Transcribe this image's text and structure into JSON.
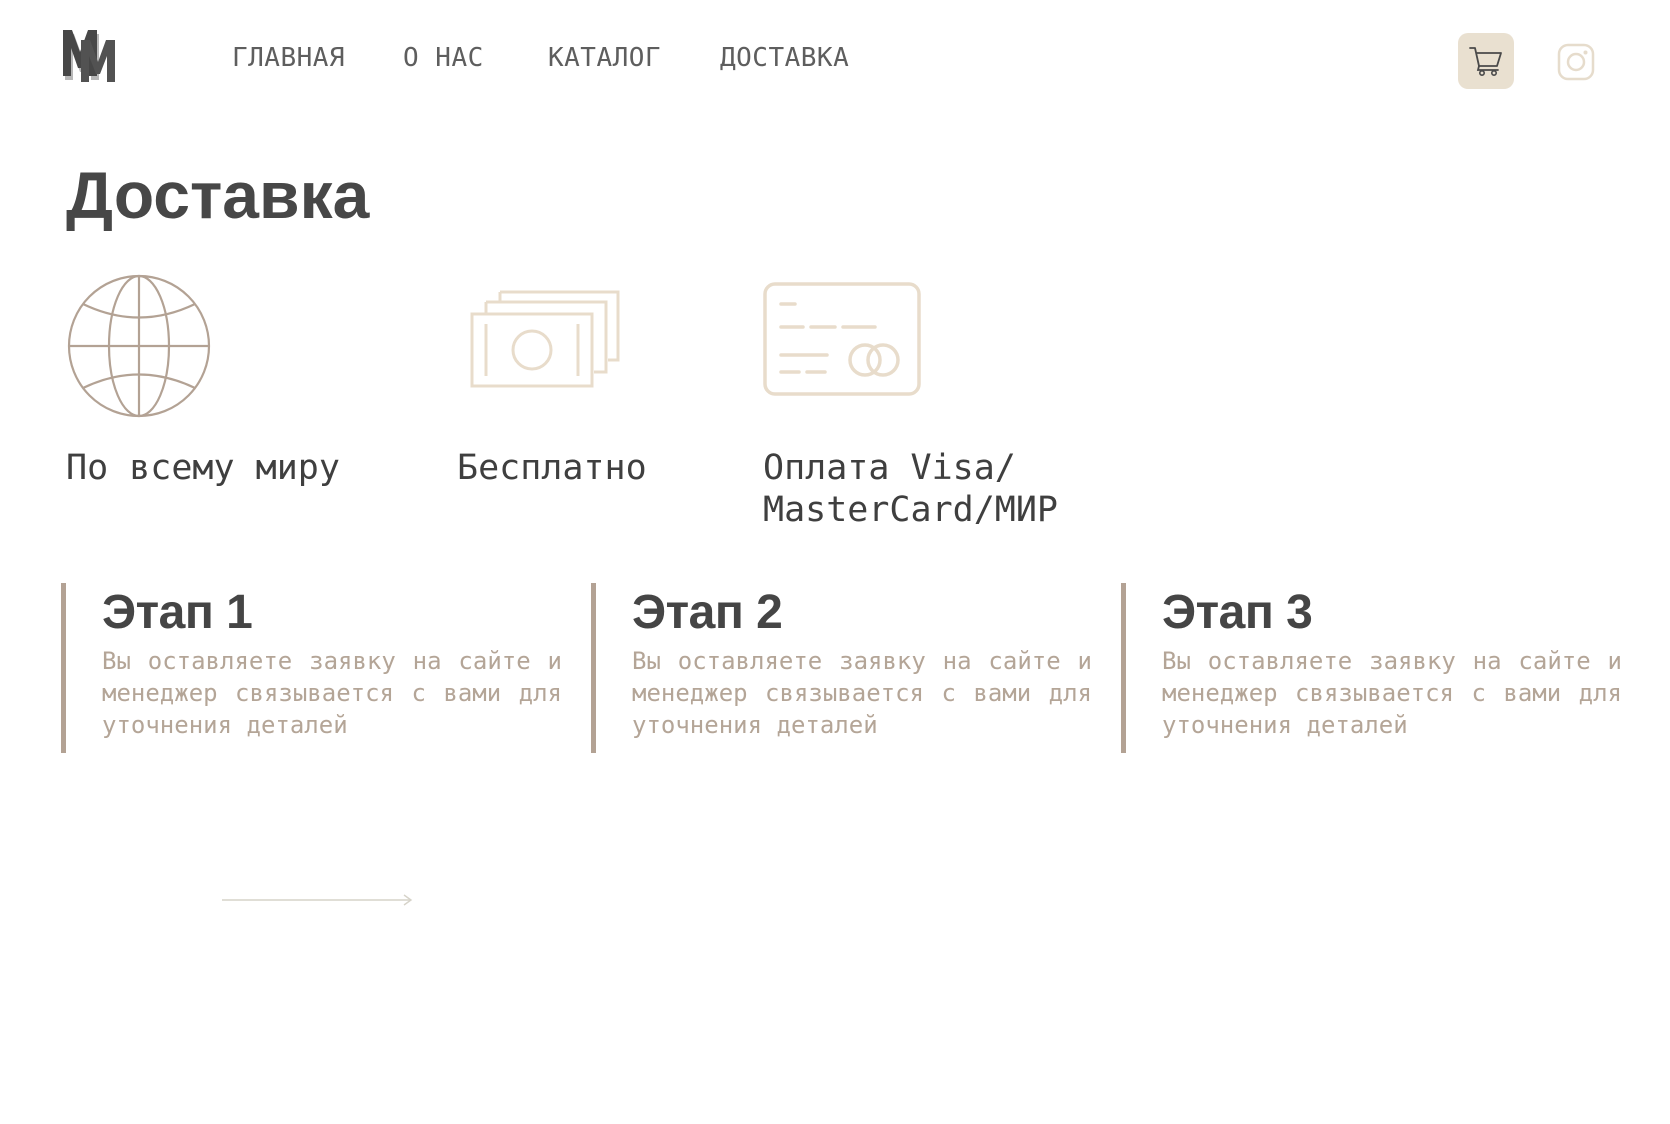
{
  "header": {
    "logo_name": "mm-logo",
    "nav": [
      "ГЛАВНАЯ",
      "О НАС",
      "КАТАЛОГ",
      "ДОСТАВКА"
    ],
    "cart_icon": "cart-icon",
    "instagram_icon": "instagram-icon"
  },
  "page": {
    "title": "Доставка"
  },
  "features": [
    {
      "icon": "globe-icon",
      "label": "По всему миру"
    },
    {
      "icon": "banknotes-icon",
      "label": "Бесплатно"
    },
    {
      "icon": "credit-card-icon",
      "label": "Оплата Visa/\nMasterCard/МИР"
    }
  ],
  "stages": [
    {
      "title": "Этап 1",
      "text": "Вы оставляете заявку на сайте и менеджер связывается с вами для уточнения деталей"
    },
    {
      "title": "Этап 2",
      "text": "Вы оставляете заявку на сайте и менеджер связывается с вами для уточнения деталей"
    },
    {
      "title": "Этап 3",
      "text": "Вы оставляете заявку на сайте и менеджер связывается с вами для уточнения деталей"
    }
  ],
  "footer": {
    "arrow_icon": "arrow-right-icon"
  },
  "colors": {
    "accent_beige": "#e9e0d0",
    "icon_brown": "#b3a294",
    "icon_light": "#e8dccb",
    "text_dark": "#474747",
    "text_muted": "#b4a597"
  }
}
